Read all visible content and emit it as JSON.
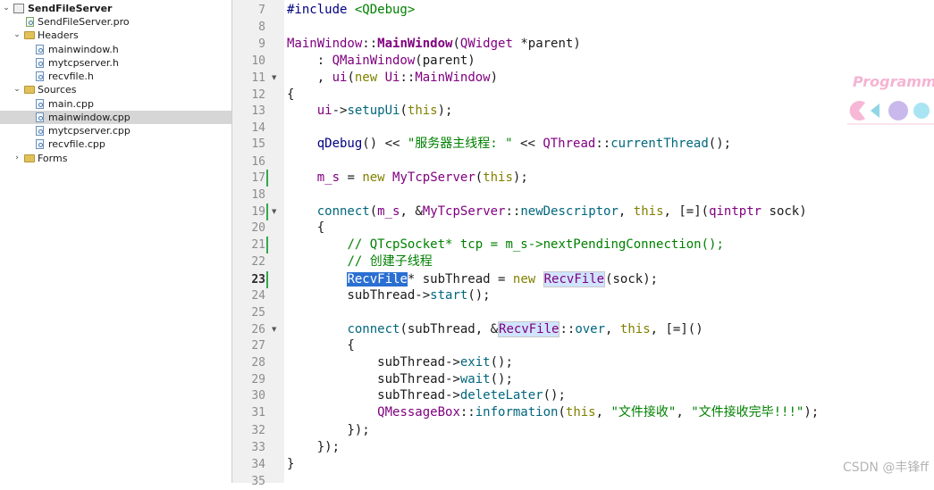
{
  "project_tree": {
    "project": "SendFileServer",
    "pro_file": "SendFileServer.pro",
    "headers_label": "Headers",
    "headers": [
      "mainwindow.h",
      "mytcpserver.h",
      "recvfile.h"
    ],
    "sources_label": "Sources",
    "sources": [
      "main.cpp",
      "mainwindow.cpp",
      "mytcpserver.cpp",
      "recvfile.cpp"
    ],
    "selected": "mainwindow.cpp",
    "forms_label": "Forms"
  },
  "editor": {
    "current_line": "23",
    "lines": [
      {
        "n": "7"
      },
      {
        "n": "8"
      },
      {
        "n": "9"
      },
      {
        "n": "10"
      },
      {
        "n": "11"
      },
      {
        "n": "12"
      },
      {
        "n": "13"
      },
      {
        "n": "14"
      },
      {
        "n": "15"
      },
      {
        "n": "16"
      },
      {
        "n": "17"
      },
      {
        "n": "18"
      },
      {
        "n": "19"
      },
      {
        "n": "20"
      },
      {
        "n": "21"
      },
      {
        "n": "22"
      },
      {
        "n": "23"
      },
      {
        "n": "24"
      },
      {
        "n": "25"
      },
      {
        "n": "26"
      },
      {
        "n": "27"
      },
      {
        "n": "28"
      },
      {
        "n": "29"
      },
      {
        "n": "30"
      },
      {
        "n": "31"
      },
      {
        "n": "32"
      },
      {
        "n": "33"
      },
      {
        "n": "34"
      },
      {
        "n": "35"
      }
    ],
    "code": {
      "l7_a": "#include ",
      "l7_b": "<QDebug>",
      "l9_a": "MainWindow",
      "l9_b": "::",
      "l9_c": "MainWindow",
      "l9_d": "(",
      "l9_e": "QWidget",
      "l9_f": " *parent)",
      "l10_a": "    : ",
      "l10_b": "QMainWindow",
      "l10_c": "(parent)",
      "l11_a": "    , ",
      "l11_b": "ui",
      "l11_c": "(",
      "l11_d": "new",
      "l11_e": " ",
      "l11_f": "Ui",
      "l11_g": "::",
      "l11_h": "MainWindow",
      "l11_i": ")",
      "l12": "{",
      "l13_a": "    ",
      "l13_b": "ui",
      "l13_c": "->",
      "l13_d": "setupUi",
      "l13_e": "(",
      "l13_f": "this",
      "l13_g": ");",
      "l15_a": "    ",
      "l15_b": "qDebug",
      "l15_c": "() << ",
      "l15_d": "\"服务器主线程: \"",
      "l15_e": " << ",
      "l15_f": "QThread",
      "l15_g": "::",
      "l15_h": "currentThread",
      "l15_i": "();",
      "l17_a": "    ",
      "l17_b": "m_s",
      "l17_c": " = ",
      "l17_d": "new",
      "l17_e": " ",
      "l17_f": "MyTcpServer",
      "l17_g": "(",
      "l17_h": "this",
      "l17_i": ");",
      "l19_a": "    ",
      "l19_b": "connect",
      "l19_c": "(",
      "l19_d": "m_s",
      "l19_e": ", &",
      "l19_f": "MyTcpServer",
      "l19_g": "::",
      "l19_h": "newDescriptor",
      "l19_i": ", ",
      "l19_j": "this",
      "l19_k": ", [=](",
      "l19_l": "qintptr",
      "l19_m": " sock)",
      "l20": "    {",
      "l21_a": "        ",
      "l21_b": "// QTcpSocket* tcp = m_s->nextPendingConnection();",
      "l22_a": "        ",
      "l22_b": "// 创建子线程",
      "l23_a": "        ",
      "l23_b": "RecvFile",
      "l23_c": "* subThread = ",
      "l23_d": "new",
      "l23_e": " ",
      "l23_f": "RecvFile",
      "l23_g": "(sock);",
      "l24_a": "        subThread->",
      "l24_b": "start",
      "l24_c": "();",
      "l26_a": "        ",
      "l26_b": "connect",
      "l26_c": "(subThread, &",
      "l26_d": "RecvFile",
      "l26_e": "::",
      "l26_f": "over",
      "l26_g": ", ",
      "l26_h": "this",
      "l26_i": ", [=]()",
      "l27": "        {",
      "l28_a": "            subThread->",
      "l28_b": "exit",
      "l28_c": "();",
      "l29_a": "            subThread->",
      "l29_b": "wait",
      "l29_c": "();",
      "l30_a": "            subThread->",
      "l30_b": "deleteLater",
      "l30_c": "();",
      "l31_a": "            ",
      "l31_b": "QMessageBox",
      "l31_c": "::",
      "l31_d": "information",
      "l31_e": "(",
      "l31_f": "this",
      "l31_g": ", ",
      "l31_h": "\"文件接收\"",
      "l31_i": ", ",
      "l31_j": "\"文件接收完毕!!!\"",
      "l31_k": ");",
      "l32": "        });",
      "l33": "    });",
      "l34": "}"
    }
  },
  "watermark": {
    "logo_text": "Programme",
    "credit": "CSDN @丰锋ff"
  },
  "colors": {
    "keyword": "#808000",
    "type": "#800080",
    "function": "#00677c",
    "string": "#008000",
    "selection": "#2a6fd1",
    "modified_bar": "#31a84d"
  }
}
